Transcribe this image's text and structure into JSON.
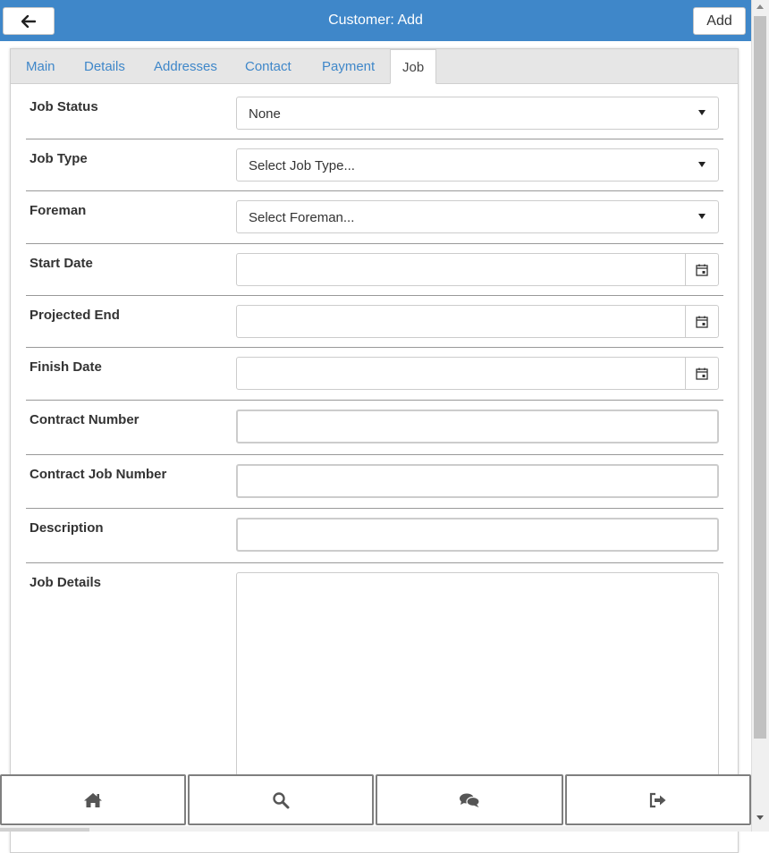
{
  "header": {
    "title": "Customer: Add",
    "add_label": "Add",
    "accent_color": "#3f87c9"
  },
  "tabs": [
    {
      "label": "Main"
    },
    {
      "label": "Details"
    },
    {
      "label": "Addresses"
    },
    {
      "label": "Contact"
    },
    {
      "label": "Payment"
    },
    {
      "label": "Job",
      "active": true
    }
  ],
  "form": {
    "job_status": {
      "label": "Job Status",
      "value": "None"
    },
    "job_type": {
      "label": "Job Type",
      "value": "Select Job Type..."
    },
    "foreman": {
      "label": "Foreman",
      "value": "Select Foreman..."
    },
    "start_date": {
      "label": "Start Date",
      "value": ""
    },
    "projected_end": {
      "label": "Projected End",
      "value": ""
    },
    "finish_date": {
      "label": "Finish Date",
      "value": ""
    },
    "contract_number": {
      "label": "Contract Number",
      "value": ""
    },
    "contract_job_number": {
      "label": "Contract Job Number",
      "value": ""
    },
    "description": {
      "label": "Description",
      "value": ""
    },
    "job_details": {
      "label": "Job Details",
      "value": ""
    }
  },
  "bottom_nav": [
    {
      "icon": "home-icon"
    },
    {
      "icon": "search-icon"
    },
    {
      "icon": "chat-icon"
    },
    {
      "icon": "sign-out-icon"
    }
  ]
}
